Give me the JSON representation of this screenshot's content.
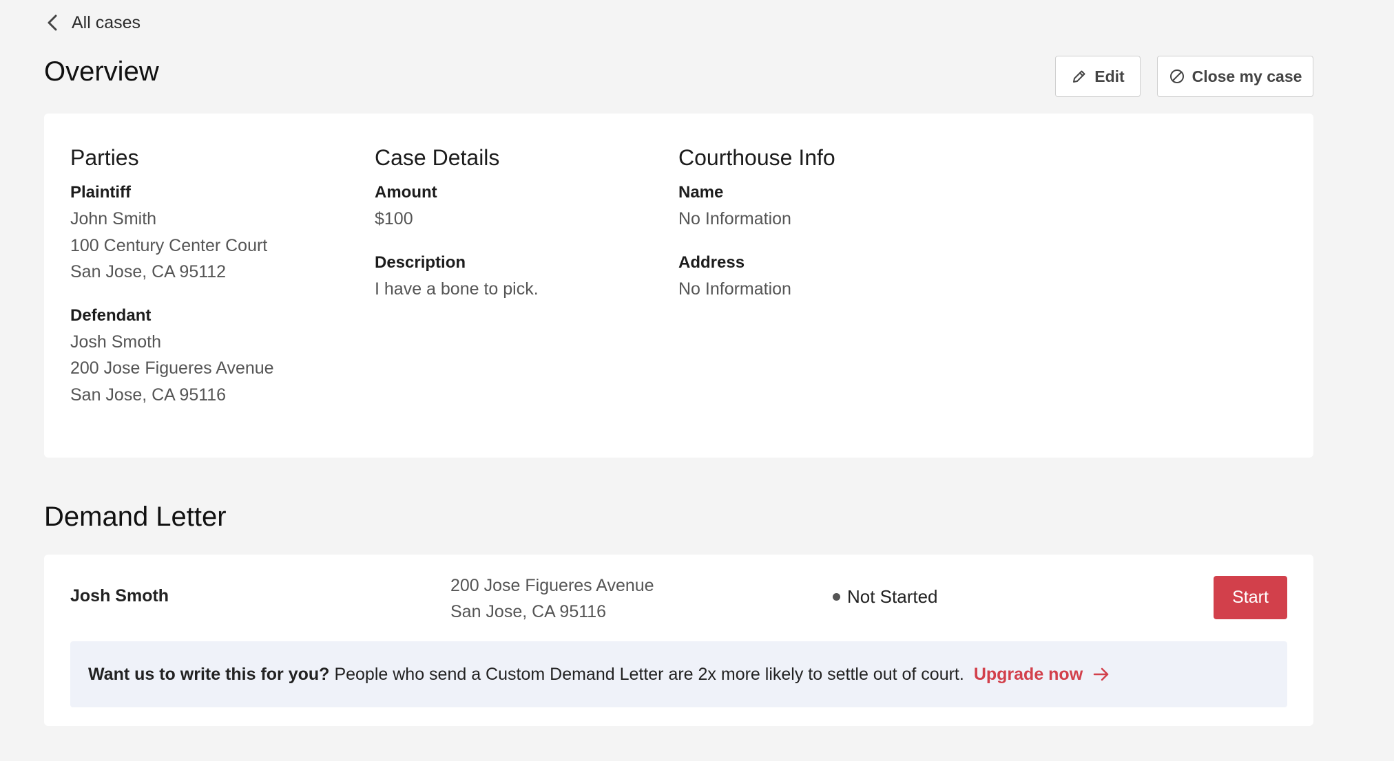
{
  "nav": {
    "back_label": "All cases"
  },
  "header": {
    "title": "Overview",
    "edit_label": "Edit",
    "close_label": "Close my case"
  },
  "overview": {
    "parties": {
      "heading": "Parties",
      "plaintiff": {
        "label": "Plaintiff",
        "name": "John Smith",
        "address_line1": "100 Century Center Court",
        "address_line2": "San Jose, CA 95112"
      },
      "defendant": {
        "label": "Defendant",
        "name": "Josh Smoth",
        "address_line1": "200 Jose Figueres Avenue",
        "address_line2": "San Jose, CA 95116"
      }
    },
    "case_details": {
      "heading": "Case Details",
      "amount_label": "Amount",
      "amount_value": "$100",
      "description_label": "Description",
      "description_value": "I have a bone to pick."
    },
    "courthouse": {
      "heading": "Courthouse Info",
      "name_label": "Name",
      "name_value": "No Information",
      "address_label": "Address",
      "address_value": "No Information"
    }
  },
  "demand_letter": {
    "title": "Demand Letter",
    "recipient_name": "Josh Smoth",
    "address_line1": "200 Jose Figueres Avenue",
    "address_line2": "San Jose, CA 95116",
    "status": "Not Started",
    "start_label": "Start",
    "upsell": {
      "bold": "Want us to write this for you?",
      "text": "People who send a Custom Demand Letter are 2x more likely to settle out of court.",
      "link": "Upgrade now"
    }
  },
  "colors": {
    "accent": "#d2404b",
    "background": "#f4f4f4",
    "upsell_bg": "#eff2f9"
  },
  "icons": {
    "back": "chevron-left-icon",
    "edit": "pencil-icon",
    "close": "circle-slash-icon",
    "upgrade": "arrow-right-icon"
  }
}
